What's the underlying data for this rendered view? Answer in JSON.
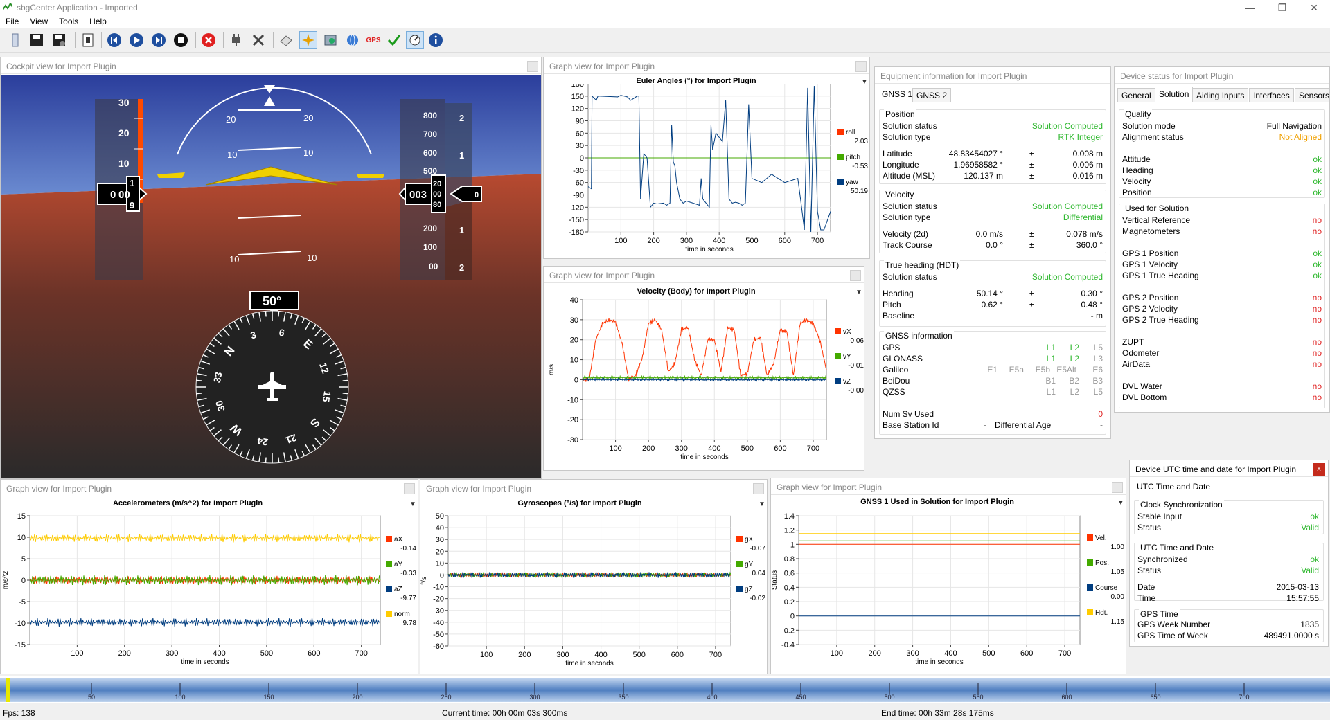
{
  "window": {
    "title": "sbgCenter Application - Imported",
    "minimize": "—",
    "maximize": "❐",
    "close": "✕"
  },
  "menu": [
    "File",
    "View",
    "Tools",
    "Help"
  ],
  "toolbar": {
    "gps_label": "GPS"
  },
  "cockpit": {
    "title": "Cockpit view for Import Plugin",
    "pitch_marks": [
      "20",
      "20",
      "10",
      "10",
      "10",
      "10"
    ],
    "speed_ticks": [
      "30",
      "20",
      "10"
    ],
    "speed_value_top": "1",
    "speed_value": "00",
    "speed_value_bottom": "9",
    "speed_value_lead": "0",
    "alt_ticks": [
      "800",
      "700",
      "600",
      "500",
      "200",
      "100",
      "00"
    ],
    "alt_right": [
      "2",
      "1",
      "1",
      "2"
    ],
    "alt_value": "003",
    "alt_drum": [
      "20",
      "00",
      "80"
    ],
    "vs_value": "0",
    "heading_value": "50°",
    "compass": [
      "N",
      "3",
      "6",
      "E",
      "12",
      "15",
      "S",
      "21",
      "24",
      "W",
      "30",
      "33"
    ]
  },
  "euler": {
    "panel_title": "Graph view for Import Plugin",
    "title": "Euler Angles (°) for Import Plugin",
    "xlabel": "time in seconds",
    "legend": [
      {
        "name": "roll",
        "value": "2.03",
        "color": "#ff3300"
      },
      {
        "name": "pitch",
        "value": "-0.53",
        "color": "#44aa00"
      },
      {
        "name": "yaw",
        "value": "50.19",
        "color": "#003d80"
      }
    ]
  },
  "velocity": {
    "panel_title": "Graph view for Import Plugin",
    "title": "Velocity (Body) for Import Plugin",
    "ylabel": "m/s",
    "xlabel": "time in seconds",
    "legend": [
      {
        "name": "vX",
        "value": "0.06",
        "color": "#ff3300"
      },
      {
        "name": "vY",
        "value": "-0.01",
        "color": "#44aa00"
      },
      {
        "name": "vZ",
        "value": "-0.00",
        "color": "#003d80"
      }
    ]
  },
  "accel": {
    "panel_title": "Graph view for Import Plugin",
    "title": "Accelerometers (m/s^2) for Import Plugin",
    "ylabel": "m/s^2",
    "xlabel": "time in seconds",
    "legend": [
      {
        "name": "aX",
        "value": "-0.14",
        "color": "#ff3300"
      },
      {
        "name": "aY",
        "value": "-0.33",
        "color": "#44aa00"
      },
      {
        "name": "aZ",
        "value": "-9.77",
        "color": "#003d80"
      },
      {
        "name": "norm",
        "value": "9.78",
        "color": "#ffcc00"
      }
    ]
  },
  "gyro": {
    "panel_title": "Graph view for Import Plugin",
    "title": "Gyroscopes (°/s) for Import Plugin",
    "ylabel": "°/s",
    "xlabel": "time in seconds",
    "legend": [
      {
        "name": "gX",
        "value": "-0.07",
        "color": "#ff3300"
      },
      {
        "name": "gY",
        "value": "0.04",
        "color": "#44aa00"
      },
      {
        "name": "gZ",
        "value": "-0.02",
        "color": "#003d80"
      }
    ]
  },
  "gnss_sol": {
    "panel_title": "Graph view for Import Plugin",
    "title": "GNSS 1 Used in Solution for Import Plugin",
    "ylabel": "Status",
    "xlabel": "time in seconds",
    "legend": [
      {
        "name": "Vel.",
        "value": "1.00",
        "color": "#ff3300"
      },
      {
        "name": "Pos.",
        "value": "1.05",
        "color": "#44aa00"
      },
      {
        "name": "Course",
        "value": "0.00",
        "color": "#003d80"
      },
      {
        "name": "Hdt.",
        "value": "1.15",
        "color": "#ffcc00"
      }
    ]
  },
  "chart_data": [
    {
      "type": "line",
      "title": "Euler Angles (°) for Import Plugin",
      "xlabel": "time in seconds",
      "ylabel": "",
      "ylim": [
        -180,
        180
      ],
      "xlim": [
        0,
        740
      ],
      "yticks": [
        180,
        150,
        120,
        90,
        60,
        30,
        0,
        -30,
        -60,
        -90,
        -120,
        -150,
        -180
      ],
      "xticks": [
        100,
        200,
        300,
        400,
        500,
        600,
        700
      ],
      "series": [
        {
          "name": "roll",
          "x": [
            0,
            740
          ],
          "y": [
            0,
            0
          ]
        },
        {
          "name": "pitch",
          "x": [
            0,
            740
          ],
          "y": [
            0,
            0
          ]
        },
        {
          "name": "yaw",
          "x": [
            0,
            10,
            12,
            25,
            30,
            90,
            100,
            110,
            120,
            130,
            150,
            155,
            160,
            170,
            180,
            190,
            200,
            210,
            230,
            240,
            250,
            255,
            260,
            265,
            270,
            280,
            290,
            300,
            320,
            340,
            345,
            350,
            360,
            370,
            375,
            380,
            390,
            400,
            410,
            420,
            430,
            440,
            450,
            460,
            470,
            480,
            490,
            500,
            530,
            560,
            600,
            640,
            650,
            660,
            670,
            680,
            690,
            700,
            710,
            720,
            740
          ],
          "y": [
            -70,
            -75,
            150,
            140,
            150,
            148,
            152,
            150,
            148,
            140,
            150,
            150,
            -100,
            10,
            0,
            -120,
            -110,
            -112,
            -110,
            -115,
            -110,
            80,
            -10,
            -20,
            -60,
            -100,
            -110,
            -105,
            -110,
            -115,
            -50,
            -100,
            -110,
            -120,
            80,
            20,
            60,
            50,
            40,
            140,
            -100,
            -110,
            -108,
            -110,
            -115,
            -110,
            130,
            -50,
            -60,
            -40,
            -60,
            -50,
            -110,
            -175,
            170,
            -180,
            175,
            -130,
            -175,
            -175,
            -130
          ]
        }
      ]
    },
    {
      "type": "line",
      "title": "Velocity (Body) for Import Plugin",
      "xlabel": "time in seconds",
      "ylabel": "m/s",
      "ylim": [
        -30,
        40
      ],
      "xlim": [
        0,
        740
      ],
      "yticks": [
        40,
        30,
        20,
        10,
        0,
        -10,
        -20,
        -30
      ],
      "xticks": [
        100,
        200,
        300,
        400,
        500,
        600,
        700
      ],
      "series": [
        {
          "name": "vX",
          "x": [
            0,
            20,
            40,
            60,
            80,
            100,
            120,
            140,
            160,
            180,
            200,
            220,
            240,
            260,
            280,
            300,
            320,
            340,
            360,
            380,
            400,
            420,
            440,
            460,
            480,
            500,
            520,
            540,
            560,
            580,
            600,
            620,
            640,
            660,
            680,
            700,
            720,
            740
          ],
          "y": [
            0,
            0,
            20,
            28,
            30,
            29,
            18,
            0,
            2,
            10,
            28,
            30,
            25,
            4,
            8,
            25,
            26,
            10,
            2,
            20,
            20,
            4,
            26,
            25,
            2,
            3,
            20,
            21,
            2,
            8,
            25,
            24,
            2,
            28,
            30,
            28,
            20,
            5
          ]
        },
        {
          "name": "vY",
          "x": [
            0,
            740
          ],
          "y": [
            1,
            1
          ]
        },
        {
          "name": "vZ",
          "x": [
            0,
            740
          ],
          "y": [
            0,
            0
          ]
        }
      ]
    },
    {
      "type": "line",
      "title": "Accelerometers (m/s^2) for Import Plugin",
      "xlabel": "time in seconds",
      "ylabel": "m/s^2",
      "ylim": [
        -15,
        15
      ],
      "xlim": [
        0,
        740
      ],
      "yticks": [
        15,
        10,
        5,
        0,
        -5,
        -10,
        -15
      ],
      "xticks": [
        100,
        200,
        300,
        400,
        500,
        600,
        700
      ],
      "series": [
        {
          "name": "aX",
          "x": [
            0,
            740
          ],
          "y": [
            0,
            0
          ]
        },
        {
          "name": "aY",
          "x": [
            0,
            740
          ],
          "y": [
            0,
            0
          ]
        },
        {
          "name": "aZ",
          "x": [
            0,
            740
          ],
          "y": [
            -9.8,
            -9.8
          ]
        },
        {
          "name": "norm",
          "x": [
            0,
            740
          ],
          "y": [
            9.8,
            9.8
          ]
        }
      ]
    },
    {
      "type": "line",
      "title": "Gyroscopes (°/s) for Import Plugin",
      "xlabel": "time in seconds",
      "ylabel": "°/s",
      "ylim": [
        -60,
        50
      ],
      "xlim": [
        0,
        740
      ],
      "yticks": [
        50,
        40,
        30,
        20,
        10,
        0,
        -10,
        -20,
        -30,
        -40,
        -50,
        -60
      ],
      "xticks": [
        100,
        200,
        300,
        400,
        500,
        600,
        700
      ],
      "series": [
        {
          "name": "gX",
          "x": [
            0,
            740
          ],
          "y": [
            0,
            0
          ]
        },
        {
          "name": "gY",
          "x": [
            0,
            740
          ],
          "y": [
            0,
            0
          ]
        },
        {
          "name": "gZ",
          "x": [
            0,
            740
          ],
          "y": [
            0,
            0
          ]
        }
      ]
    },
    {
      "type": "line",
      "title": "GNSS 1 Used in Solution for Import Plugin",
      "xlabel": "time in seconds",
      "ylabel": "Status",
      "ylim": [
        -0.4,
        1.4
      ],
      "xlim": [
        0,
        740
      ],
      "yticks": [
        1.4,
        1.2,
        1.0,
        0.8,
        0.6,
        0.4,
        0.2,
        0.0,
        -0.2,
        -0.4
      ],
      "xticks": [
        100,
        200,
        300,
        400,
        500,
        600,
        700
      ],
      "series": [
        {
          "name": "Vel.",
          "x": [
            0,
            740
          ],
          "y": [
            1,
            1
          ]
        },
        {
          "name": "Pos.",
          "x": [
            0,
            740
          ],
          "y": [
            1.05,
            1.05
          ]
        },
        {
          "name": "Course",
          "x": [
            0,
            740
          ],
          "y": [
            0,
            0
          ]
        },
        {
          "name": "Hdt.",
          "x": [
            0,
            740
          ],
          "y": [
            1.15,
            1.15
          ]
        }
      ]
    }
  ],
  "equipment": {
    "title": "Equipment information for Import Plugin",
    "tabs": [
      "GNSS 1",
      "GNSS 2"
    ],
    "position": {
      "title": "Position",
      "status_label": "Solution status",
      "status": "Solution Computed",
      "type_label": "Solution type",
      "type": "RTK Integer",
      "rows": [
        {
          "label": "Latitude",
          "value": "48.83454027 °",
          "pm": "±",
          "acc": "0.008 m"
        },
        {
          "label": "Longitude",
          "value": "1.96958582 °",
          "pm": "±",
          "acc": "0.006 m"
        },
        {
          "label": "Altitude (MSL)",
          "value": "120.137 m",
          "pm": "±",
          "acc": "0.016 m"
        }
      ]
    },
    "velocity": {
      "title": "Velocity",
      "status_label": "Solution status",
      "status": "Solution Computed",
      "type_label": "Solution type",
      "type": "Differential",
      "rows": [
        {
          "label": "Velocity (2d)",
          "value": "0.0 m/s",
          "pm": "±",
          "acc": "0.078 m/s"
        },
        {
          "label": "Track Course",
          "value": "0.0 °",
          "pm": "±",
          "acc": "360.0 °"
        }
      ]
    },
    "heading": {
      "title": "True heading (HDT)",
      "status_label": "Solution status",
      "status": "Solution Computed",
      "rows": [
        {
          "label": "Heading",
          "value": "50.14 °",
          "pm": "±",
          "acc": "0.30 °"
        },
        {
          "label": "Pitch",
          "value": "0.62 °",
          "pm": "±",
          "acc": "0.48 °"
        },
        {
          "label": "Baseline",
          "value": "",
          "pm": "",
          "acc": "- m"
        }
      ]
    },
    "gnss": {
      "title": "GNSS information",
      "rows": [
        {
          "label": "GPS",
          "bands": [
            {
              "t": "L1",
              "c": "green"
            },
            {
              "t": "L2",
              "c": "green"
            },
            {
              "t": "L5",
              "c": "gray"
            }
          ]
        },
        {
          "label": "GLONASS",
          "bands": [
            {
              "t": "L1",
              "c": "green"
            },
            {
              "t": "L2",
              "c": "green"
            },
            {
              "t": "L3",
              "c": "gray"
            }
          ]
        },
        {
          "label": "Galileo",
          "bands": [
            {
              "t": "E1",
              "c": "gray"
            },
            {
              "t": "E5a",
              "c": "gray"
            },
            {
              "t": "E5b",
              "c": "gray"
            },
            {
              "t": "E5Alt",
              "c": "gray"
            },
            {
              "t": "E6",
              "c": "gray"
            }
          ]
        },
        {
          "label": "BeiDou",
          "bands": [
            {
              "t": "B1",
              "c": "gray"
            },
            {
              "t": "B2",
              "c": "gray"
            },
            {
              "t": "B3",
              "c": "gray"
            }
          ]
        },
        {
          "label": "QZSS",
          "bands": [
            {
              "t": "L1",
              "c": "gray"
            },
            {
              "t": "L2",
              "c": "gray"
            },
            {
              "t": "L5",
              "c": "gray"
            }
          ]
        }
      ],
      "numsv_label": "Num Sv Used",
      "numsv": "0",
      "base_label": "Base Station Id",
      "base": "-",
      "diff_label": "Differential Age",
      "diff": "-"
    }
  },
  "device": {
    "title": "Device status for Import Plugin",
    "tabs": [
      "General",
      "Solution",
      "Aiding Inputs",
      "Interfaces",
      "Sensors"
    ],
    "quality": {
      "title": "Quality",
      "mode_label": "Solution mode",
      "mode": "Full Navigation",
      "align_label": "Alignment status",
      "align": "Not Aligned",
      "rows": [
        {
          "label": "Attitude",
          "value": "ok"
        },
        {
          "label": "Heading",
          "value": "ok"
        },
        {
          "label": "Velocity",
          "value": "ok"
        },
        {
          "label": "Position",
          "value": "ok"
        }
      ]
    },
    "used": {
      "title": "Used for Solution",
      "rows": [
        {
          "label": "Vertical Reference",
          "value": "no",
          "c": "red"
        },
        {
          "label": "Magnetometers",
          "value": "no",
          "c": "red"
        },
        {
          "label": "GPS 1 Position",
          "value": "ok",
          "c": "green"
        },
        {
          "label": "GPS 1 Velocity",
          "value": "ok",
          "c": "green"
        },
        {
          "label": "GPS 1 True Heading",
          "value": "ok",
          "c": "green"
        },
        {
          "label": "GPS 2 Position",
          "value": "no",
          "c": "red"
        },
        {
          "label": "GPS 2 Velocity",
          "value": "no",
          "c": "red"
        },
        {
          "label": "GPS 2 True Heading",
          "value": "no",
          "c": "red"
        },
        {
          "label": "ZUPT",
          "value": "no",
          "c": "red"
        },
        {
          "label": "Odometer",
          "value": "no",
          "c": "red"
        },
        {
          "label": "AirData",
          "value": "no",
          "c": "red"
        },
        {
          "label": "DVL Water",
          "value": "no",
          "c": "red"
        },
        {
          "label": "DVL Bottom",
          "value": "no",
          "c": "red"
        }
      ]
    }
  },
  "utc": {
    "title": "Device UTC time and date for Import Plugin",
    "close": "x",
    "tab": "UTC Time and Date",
    "clock": {
      "title": "Clock Synchronization",
      "rows": [
        {
          "label": "Stable Input",
          "value": "ok"
        },
        {
          "label": "Status",
          "value": "Valid"
        }
      ]
    },
    "utctd": {
      "title": "UTC Time and Date",
      "rows": [
        {
          "label": "Synchronized",
          "value": "ok",
          "c": "green"
        },
        {
          "label": "Status",
          "value": "Valid",
          "c": "green"
        },
        {
          "label": "Date",
          "value": "2015-03-13",
          "c": ""
        },
        {
          "label": "Time",
          "value": "15:57:55",
          "c": ""
        }
      ]
    },
    "gps": {
      "title": "GPS Time",
      "rows": [
        {
          "label": "GPS Week Number",
          "value": "1835"
        },
        {
          "label": "GPS Time of Week",
          "value": "489491.0000 s"
        }
      ]
    }
  },
  "timeline": {
    "ticks": [
      "50",
      "100",
      "150",
      "200",
      "250",
      "300",
      "350",
      "400",
      "450",
      "500",
      "550",
      "600",
      "650",
      "700"
    ]
  },
  "status": {
    "fps": "Fps: 138",
    "current": "Current time: 00h 00m 03s 300ms",
    "end": "End time: 00h 33m 28s 175ms"
  }
}
